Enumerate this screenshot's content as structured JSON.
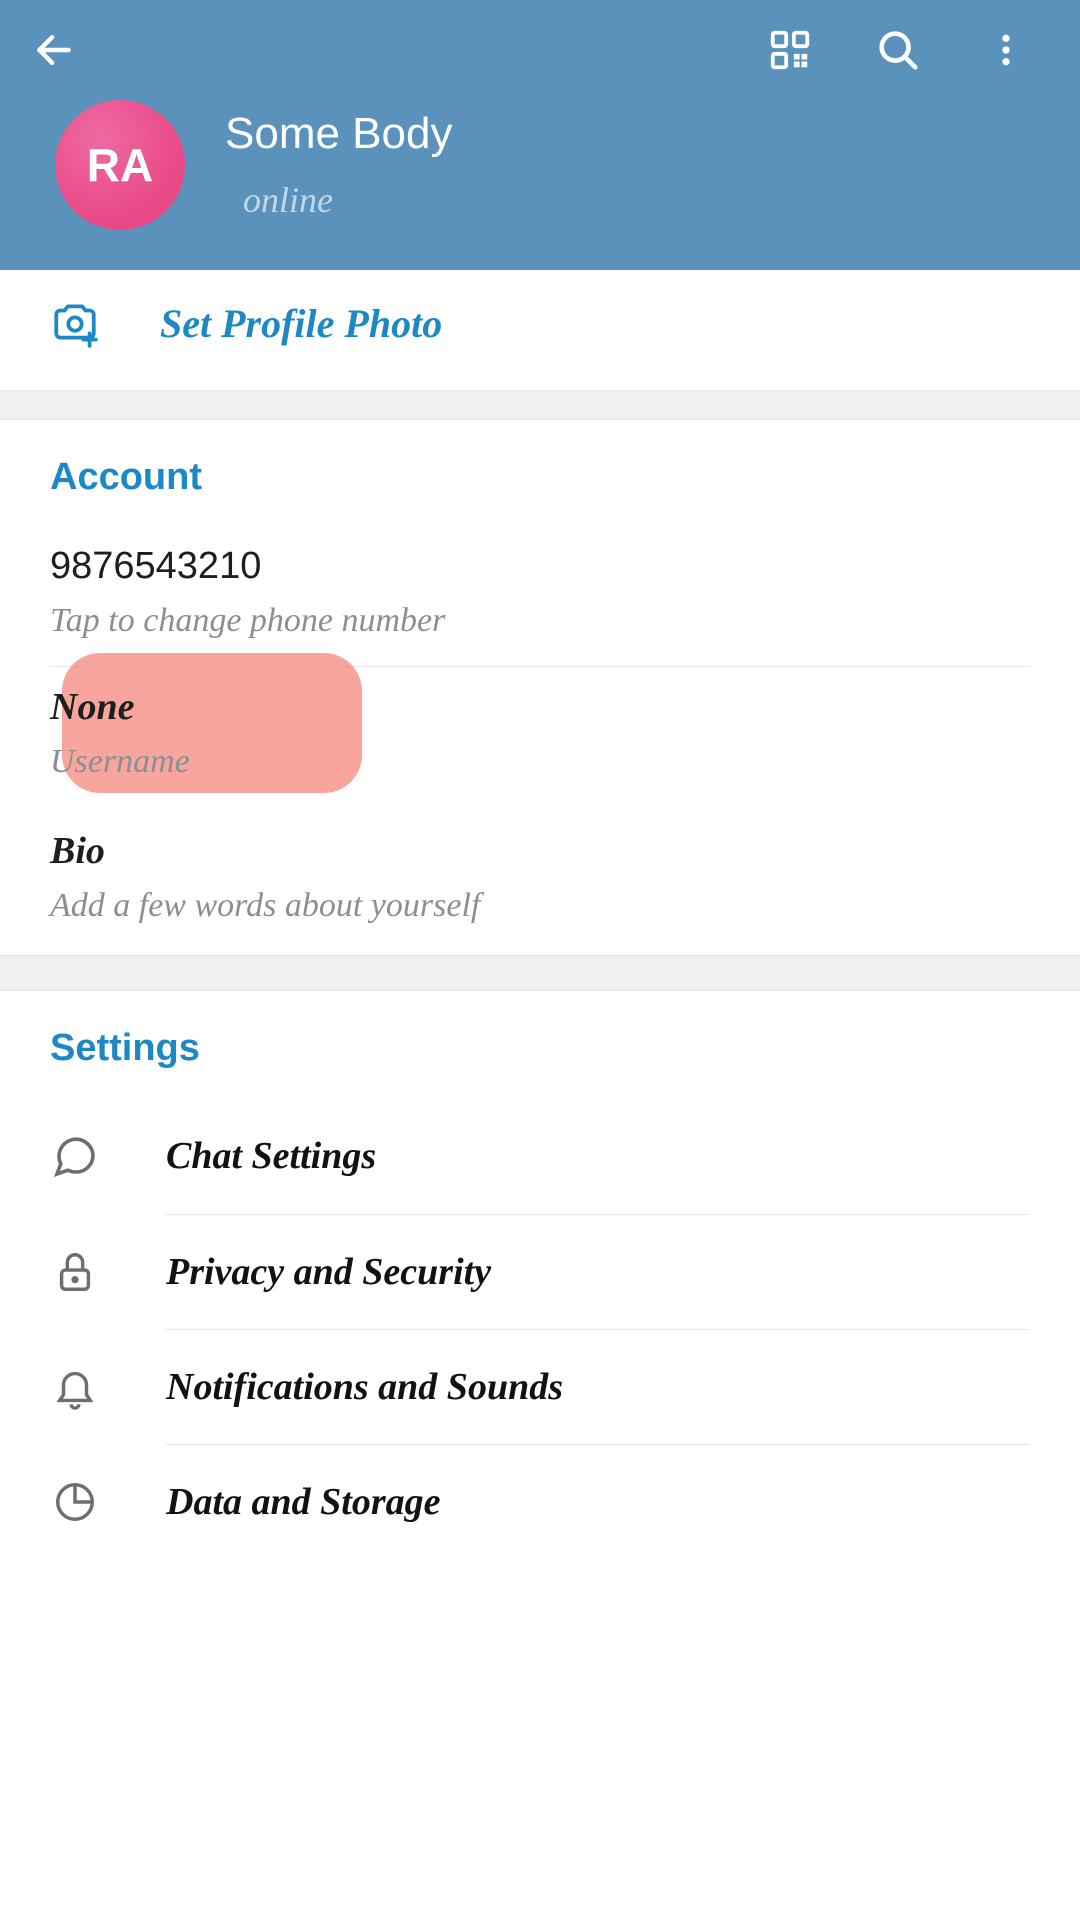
{
  "header": {
    "avatar_initials": "RA",
    "name": "Some Body",
    "status": "online"
  },
  "profile_photo": {
    "label": "Set Profile Photo"
  },
  "account": {
    "title": "Account",
    "phone": {
      "value": "9876543210",
      "hint": "Tap to change phone number"
    },
    "username": {
      "value": "None",
      "hint": "Username"
    },
    "bio": {
      "value": "Bio",
      "hint": "Add a few words about yourself"
    }
  },
  "settings": {
    "title": "Settings",
    "items": [
      {
        "label": "Chat Settings",
        "icon": "chat"
      },
      {
        "label": "Privacy and Security",
        "icon": "lock"
      },
      {
        "label": "Notifications and Sounds",
        "icon": "bell"
      },
      {
        "label": "Data and Storage",
        "icon": "pie"
      }
    ]
  }
}
